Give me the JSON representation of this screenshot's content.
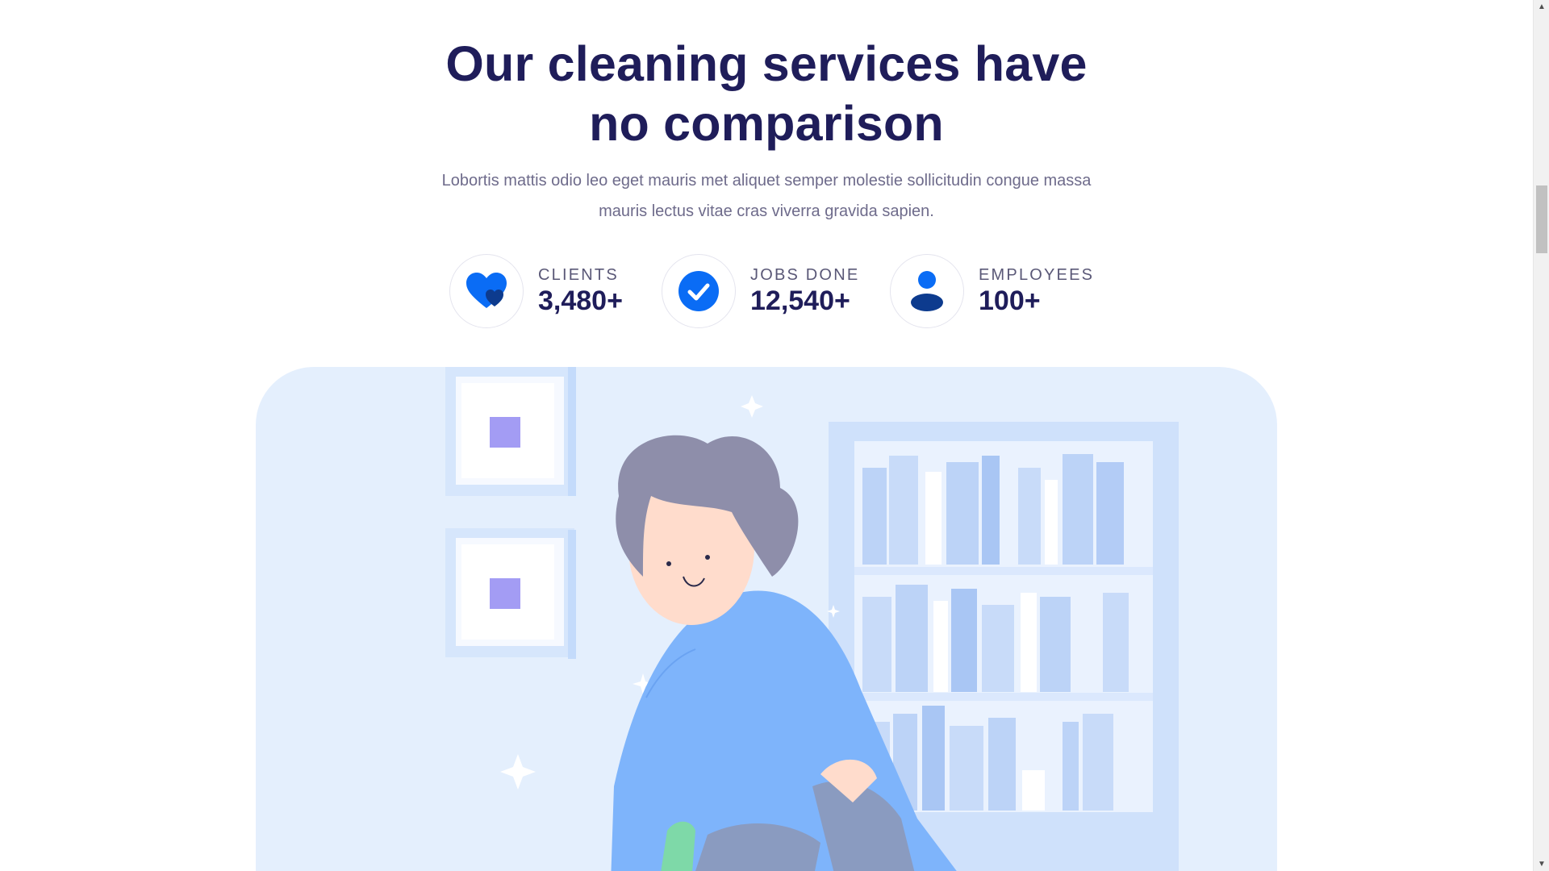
{
  "section": {
    "heading_line1": "Our cleaning services have",
    "heading_line2": "no comparison",
    "description": "Lobortis mattis odio leo eget mauris met aliquet semper molestie sollicitudin congue massa mauris lectus vitae cras viverra gravida sapien."
  },
  "stats": [
    {
      "label": "CLIENTS",
      "value": "3,480+",
      "icon": "heart-icon"
    },
    {
      "label": "JOBS DONE",
      "value": "12,540+",
      "icon": "check-circle-icon"
    },
    {
      "label": "EMPLOYEES",
      "value": "100+",
      "icon": "person-icon"
    }
  ],
  "illustration": {
    "subject": "person-cleaning-bookshelf"
  },
  "colors": {
    "heading": "#1f1d5a",
    "accent": "#0a6cf5",
    "illustration_bg": "#e4effd"
  }
}
